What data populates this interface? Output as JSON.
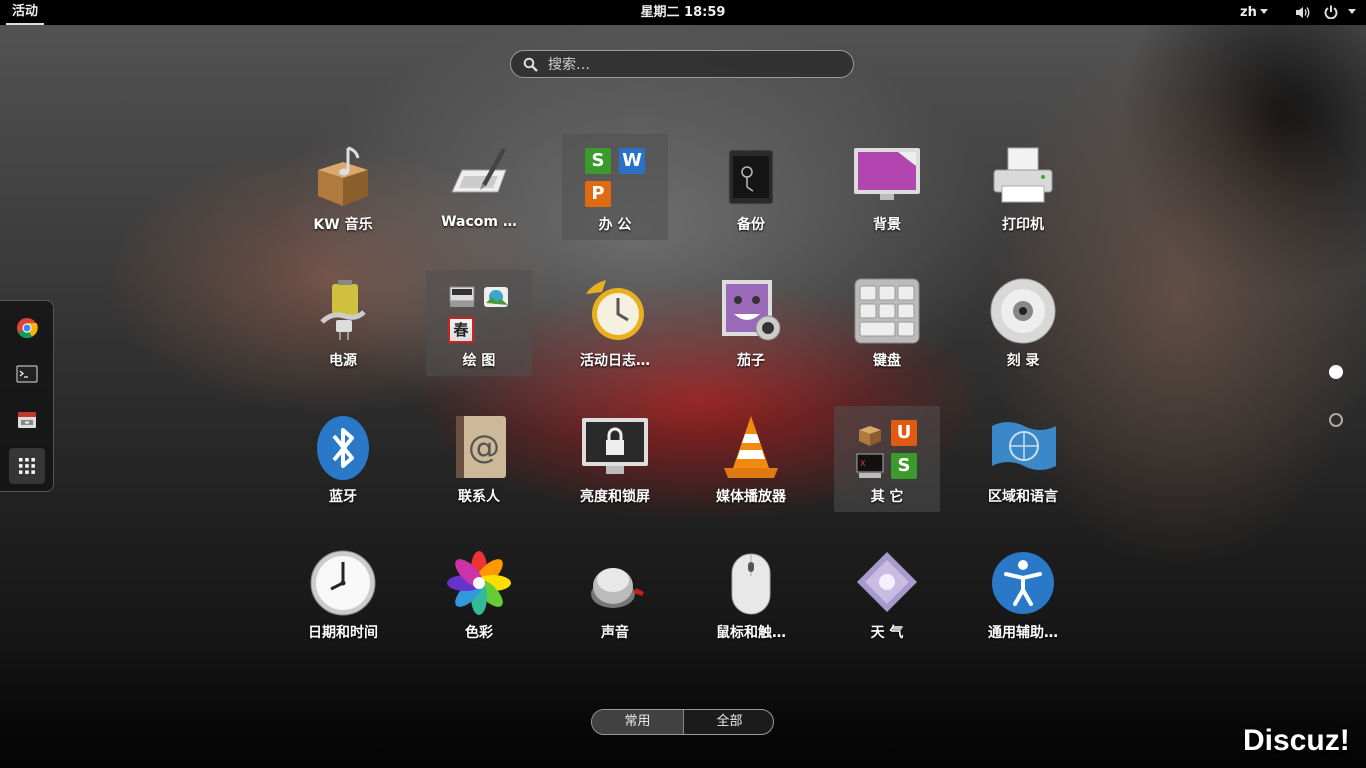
{
  "topbar": {
    "activities": "活动",
    "clock": "星期二 18:59",
    "language": "zh"
  },
  "search": {
    "placeholder": "搜索…"
  },
  "dash": {
    "items": [
      {
        "icon": "chrome-icon"
      },
      {
        "icon": "terminal-icon"
      },
      {
        "icon": "file-manager-icon"
      },
      {
        "icon": "show-applications-icon"
      }
    ]
  },
  "apps": [
    {
      "label": "KW 音乐",
      "icon": "music-box-icon"
    },
    {
      "label": "Wacom …",
      "icon": "wacom-tablet-icon"
    },
    {
      "label": "办 公",
      "icon": "office-folder-icon"
    },
    {
      "label": "备份",
      "icon": "backup-safe-icon"
    },
    {
      "label": "背景",
      "icon": "background-monitor-icon"
    },
    {
      "label": "打印机",
      "icon": "printer-icon"
    },
    {
      "label": "电源",
      "icon": "power-battery-icon"
    },
    {
      "label": "绘 图",
      "icon": "graphics-folder-icon"
    },
    {
      "label": "活动日志…",
      "icon": "activity-log-clock-icon"
    },
    {
      "label": "茄子",
      "icon": "cheese-webcam-icon"
    },
    {
      "label": "键盘",
      "icon": "keyboard-icon"
    },
    {
      "label": "刻 录",
      "icon": "disc-burner-icon"
    },
    {
      "label": "蓝牙",
      "icon": "bluetooth-icon"
    },
    {
      "label": "联系人",
      "icon": "contacts-book-icon"
    },
    {
      "label": "亮度和锁屏",
      "icon": "lock-screen-icon"
    },
    {
      "label": "媒体播放器",
      "icon": "vlc-cone-icon"
    },
    {
      "label": "其 它",
      "icon": "other-folder-icon"
    },
    {
      "label": "区域和语言",
      "icon": "region-flag-icon"
    },
    {
      "label": "日期和时间",
      "icon": "clock-icon"
    },
    {
      "label": "色彩",
      "icon": "color-flower-icon"
    },
    {
      "label": "声音",
      "icon": "sound-knob-icon"
    },
    {
      "label": "鼠标和触…",
      "icon": "mouse-icon"
    },
    {
      "label": "天 气",
      "icon": "weather-icon"
    },
    {
      "label": "通用辅助…",
      "icon": "accessibility-icon"
    }
  ],
  "office_folder": {
    "tiles": [
      "S",
      "W",
      "P"
    ]
  },
  "graphics_folder": {
    "tiles": [
      "春"
    ]
  },
  "other_folder": {
    "tiles": [
      "U",
      "S"
    ]
  },
  "view_toggle": {
    "frequent": "常用",
    "all": "全部"
  },
  "watermark": "Discuz!",
  "colors": {
    "wps_green": "#3a9a2c",
    "wps_blue": "#2a72c8",
    "wps_orange": "#e06a10",
    "accent_red": "#c81e1e"
  }
}
